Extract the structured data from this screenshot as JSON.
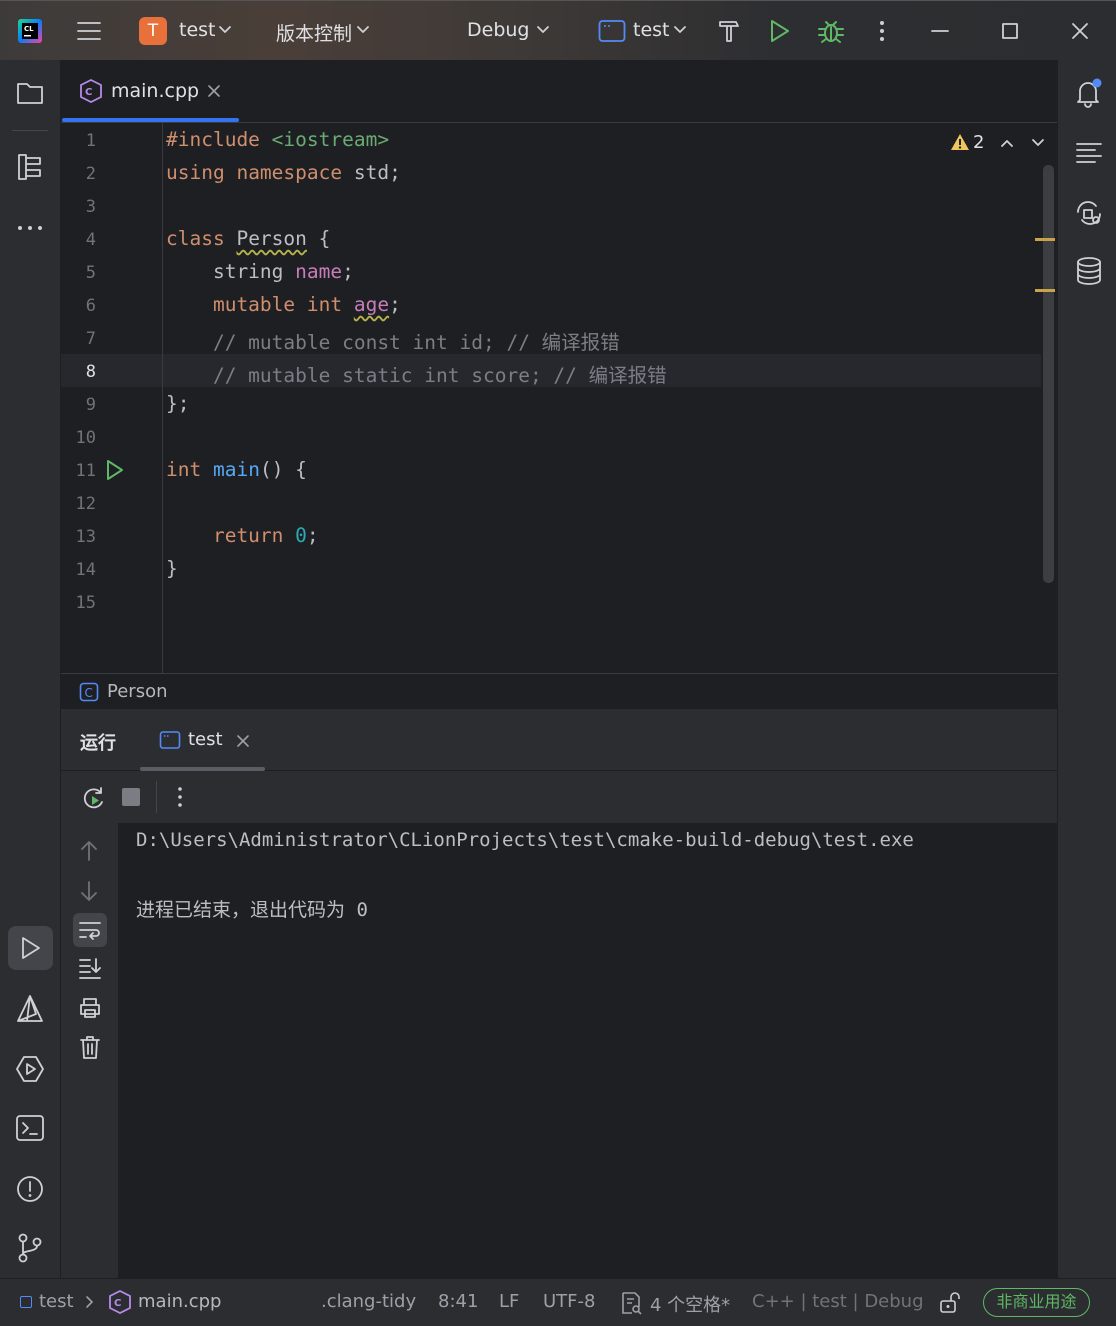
{
  "titlebar": {
    "project_badge": "T",
    "project_name": "test",
    "vcs_label": "版本控制",
    "config_label": "Debug",
    "run_target": "test"
  },
  "editor": {
    "tab_label": "main.cpp",
    "warning_count": "2",
    "line_numbers": [
      "1",
      "2",
      "3",
      "4",
      "5",
      "6",
      "7",
      "8",
      "9",
      "10",
      "11",
      "12",
      "13",
      "14",
      "15"
    ],
    "code": {
      "l1a": "#include",
      "l1b": " <iostream>",
      "l2a": "using",
      "l2b": " ",
      "l2c": "namespace",
      "l2d": " std;",
      "l4a": "class",
      "l4b": " ",
      "l4c": "Person",
      "l4d": " {",
      "l5a": "    string ",
      "l5b": "name",
      "l5c": ";",
      "l6a": "    mutable int ",
      "l6b": "age",
      "l6c": ";",
      "l7": "    // mutable const int id; // 编译报错",
      "l8": "    // mutable static int score; // 编译报错",
      "l9": "};",
      "l11a": "int",
      "l11b": " ",
      "l11c": "main",
      "l11d": "() {",
      "l13a": "    return",
      "l13b": " ",
      "l13c": "0",
      "l13d": ";",
      "l14": "}"
    },
    "breadcrumb_label": "Person"
  },
  "run_panel": {
    "title": "运行",
    "tab_label": "test",
    "console_line1": "D:\\Users\\Administrator\\CLionProjects\\test\\cmake-build-debug\\test.exe",
    "console_line2": "进程已结束，退出代码为 0"
  },
  "statusbar": {
    "project": "test",
    "file": "main.cpp",
    "linter": ".clang-tidy",
    "position": "8:41",
    "line_ending": "LF",
    "encoding": "UTF-8",
    "indent": "4 个空格*",
    "context": "C++ | test | Debug",
    "license": "非商业用途"
  },
  "colors": {
    "accent": "#3574f0",
    "run_green": "#5fb865",
    "warning": "#f2c55c",
    "license_green": "#5fb865"
  }
}
